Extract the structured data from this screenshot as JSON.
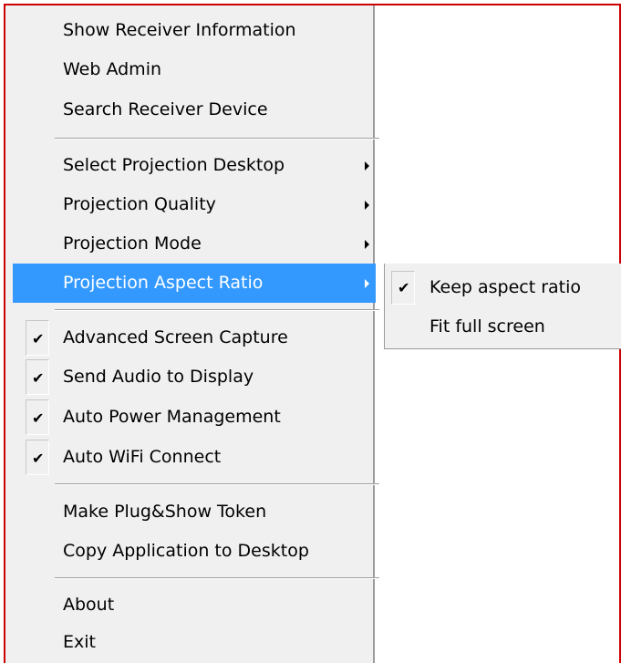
{
  "main_menu": {
    "group1": [
      {
        "label": "Show Receiver Information"
      },
      {
        "label": "Web Admin"
      },
      {
        "label": "Search Receiver Device"
      }
    ],
    "group2": [
      {
        "label": "Select Projection Desktop",
        "has_submenu": true
      },
      {
        "label": "Projection Quality",
        "has_submenu": true
      },
      {
        "label": "Projection Mode",
        "has_submenu": true
      },
      {
        "label": "Projection Aspect Ratio",
        "has_submenu": true,
        "highlighted": true
      }
    ],
    "group3": [
      {
        "label": "Advanced Screen Capture",
        "checked": true
      },
      {
        "label": "Send Audio to Display",
        "checked": true
      },
      {
        "label": "Auto Power Management",
        "checked": true
      },
      {
        "label": "Auto WiFi Connect",
        "checked": true
      }
    ],
    "group4": [
      {
        "label": "Make Plug&Show Token"
      },
      {
        "label": "Copy Application to Desktop"
      }
    ],
    "group5": [
      {
        "label": "About"
      },
      {
        "label": "Exit"
      }
    ]
  },
  "submenu": {
    "items": [
      {
        "label": "Keep aspect ratio",
        "checked": true
      },
      {
        "label": "Fit full screen",
        "checked": false
      }
    ]
  },
  "check_glyph": "✔",
  "colors": {
    "menu_background": "#f0f0f0",
    "highlight": "#3399ff",
    "frame": "#cc0000"
  },
  "icons": {
    "submenu_arrow": "chevron-right-icon",
    "check": "check-icon"
  }
}
